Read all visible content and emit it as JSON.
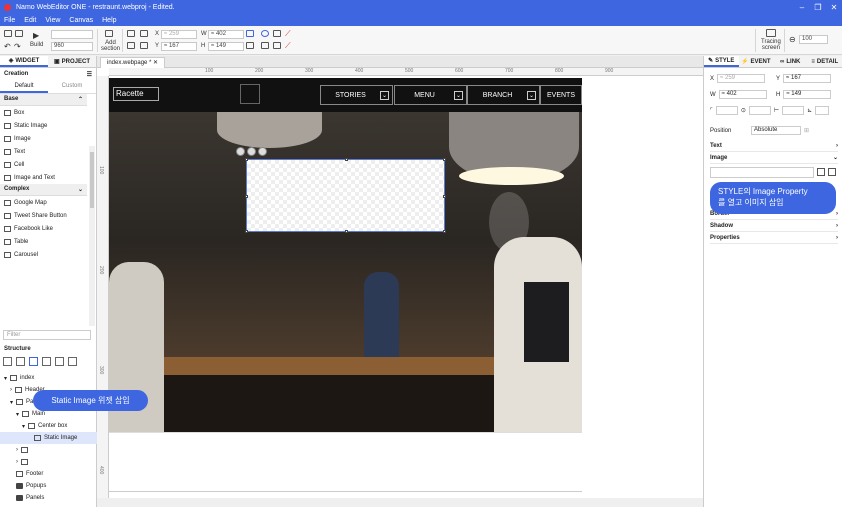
{
  "app": {
    "title": "Namo WebEditor ONE - restraunt.webproj - Edited.",
    "window_controls": [
      "–",
      "❐",
      "✕"
    ],
    "menu": [
      "File",
      "Edit",
      "View",
      "Canvas",
      "Help"
    ]
  },
  "toolbar": {
    "build_label": "Build",
    "width_select": "960",
    "add_section": "Add\nsection",
    "x_label": "X",
    "x_value": "≈ 259",
    "y_label": "Y",
    "y_value": "≈ 167",
    "w_label": "W",
    "w_value": "≈ 402",
    "h_label": "H",
    "h_value": "≈ 149",
    "tracing_label": "Tracing\nscreen",
    "zoom_value": "100"
  },
  "left_panel": {
    "tabs": [
      "WIDGET",
      "PROJECT"
    ],
    "creation_label": "Creation",
    "subtabs": [
      "Default",
      "Custom"
    ],
    "groups": [
      {
        "name": "Base",
        "items": [
          "Box",
          "Static Image",
          "Image",
          "Text",
          "Cell",
          "Image and Text"
        ]
      },
      {
        "name": "Complex",
        "items": [
          "Google Map",
          "Tweet Share Button",
          "Facebook Like",
          "Table",
          "Carousel"
        ]
      }
    ],
    "filter_placeholder": "Filter",
    "structure_label": "Structure",
    "tree": [
      "index",
      "Header",
      "Page Content",
      "Main",
      "Center box",
      "Static Image",
      "Footer",
      "Popups",
      "Panels"
    ]
  },
  "document": {
    "tab": "index.webpage *",
    "ruler_labels": [
      "100",
      "200",
      "300",
      "400",
      "500",
      "600",
      "700",
      "800",
      "900"
    ],
    "ruler_left_labels": [
      "100",
      "200",
      "300",
      "400"
    ],
    "site": {
      "logo": "Racette",
      "nav": [
        "STORIES",
        "MENU",
        "BRANCH",
        "EVENTS"
      ]
    }
  },
  "right_panel": {
    "tabs": [
      "STYLE",
      "EVENT",
      "LINK",
      "DETAIL"
    ],
    "x": "≈ 259",
    "y": "≈ 167",
    "w": "≈ 402",
    "h": "≈ 149",
    "position_label": "Position",
    "position_value": "Absolute",
    "sections": [
      "Text",
      "Image",
      "Border",
      "Shadow",
      "Properties"
    ]
  },
  "callouts": {
    "left": "Static Image 위젯 삽입",
    "right": "STYLE의 Image Property\n를 열고 이미지 삽입"
  },
  "colors": {
    "accent": "#3d66e0",
    "nav_bg": "#111111"
  }
}
